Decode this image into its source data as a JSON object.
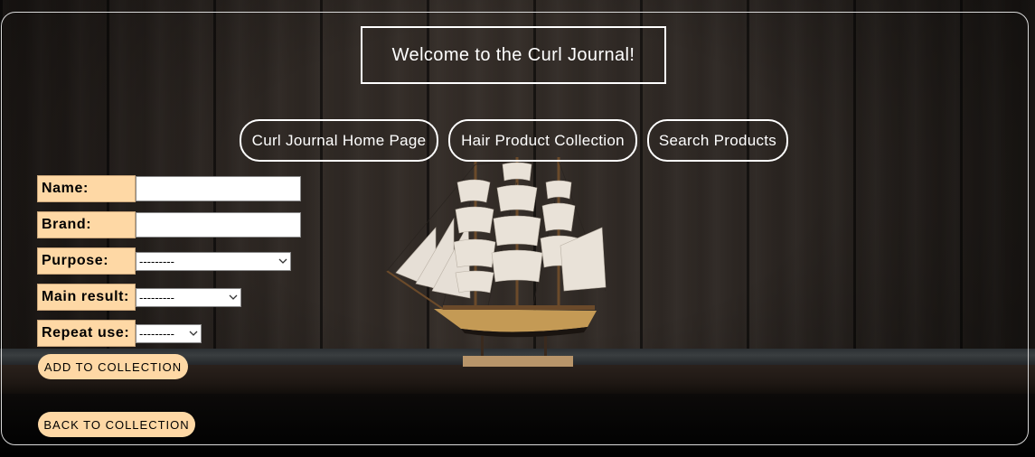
{
  "header": {
    "welcome": "Welcome to the Curl Journal!"
  },
  "nav": {
    "home": "Curl Journal Home Page",
    "collection": "Hair Product Collection",
    "search": "Search Products"
  },
  "form": {
    "name_label": "Name:",
    "name_value": "",
    "brand_label": "Brand:",
    "brand_value": "",
    "purpose_label": "Purpose:",
    "purpose_selected": "---------",
    "main_result_label": "Main result:",
    "main_result_selected": "---------",
    "repeat_use_label": "Repeat use:",
    "repeat_use_selected": "---------",
    "add_button": "ADD TO COLLECTION"
  },
  "footer": {
    "back_button": "BACK TO COLLECTION"
  },
  "colors": {
    "accent": "#fed8a5",
    "text_light": "#ffffff",
    "border_light": "#d9d9d9"
  },
  "icons": {
    "select_chevron": "chevron-down-icon"
  }
}
